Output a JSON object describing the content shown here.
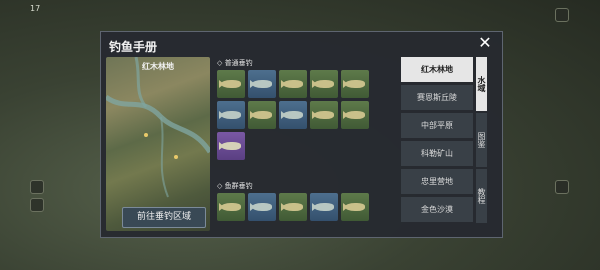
{
  "hud": {
    "level": "17"
  },
  "dialog": {
    "title": "钓鱼手册",
    "map_label": "红木林地",
    "goto_label": "前往垂钓区域",
    "sections": [
      {
        "title": "◇ 普通垂钓",
        "fish": [
          "green",
          "blue",
          "green",
          "green",
          "green",
          "blue",
          "green",
          "blue",
          "green",
          "green",
          "purple"
        ]
      },
      {
        "title": "◇ 鱼群垂钓",
        "fish": [
          "green",
          "blue",
          "green",
          "blue",
          "green"
        ]
      }
    ],
    "locations": [
      "红木林地",
      "赛恩斯丘陵",
      "中部平原",
      "科勒矿山",
      "忠里营地",
      "金色沙漠"
    ],
    "active_location": 0,
    "tabs": [
      "水域",
      "图鉴",
      "教程"
    ],
    "active_tab": 0
  }
}
